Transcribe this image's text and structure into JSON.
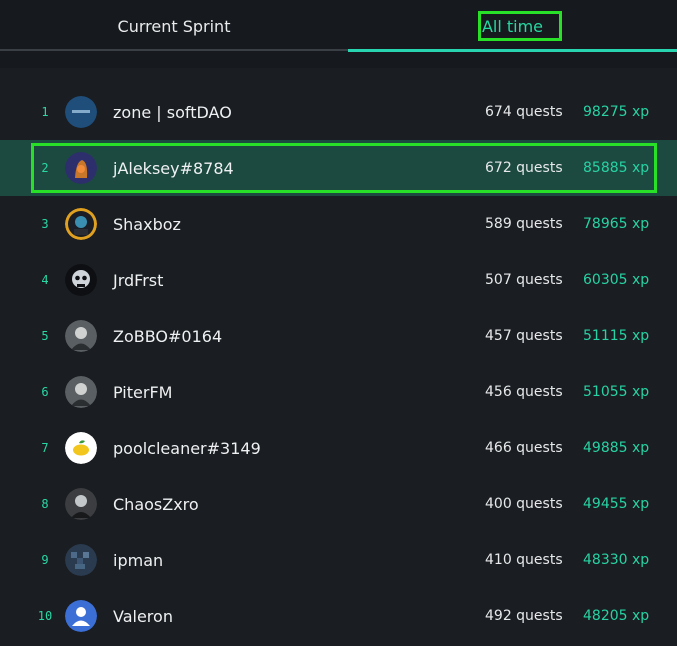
{
  "tabs": [
    {
      "label": "Current Sprint",
      "active": false
    },
    {
      "label": "All time",
      "active": true
    }
  ],
  "colors": {
    "accent": "#27d5b0",
    "selected_row": "#1d4a40",
    "highlight_box": "#27e027"
  },
  "leaderboard": [
    {
      "rank": "1",
      "name": "zone | softDAO",
      "quests": "674 quests",
      "xp": "98275 xp",
      "avatar": "softdao-logo-avatar"
    },
    {
      "rank": "2",
      "name": "jAleksey#8784",
      "quests": "672 quests",
      "xp": "85885 xp",
      "avatar": "hooded-figure-avatar",
      "selected": true
    },
    {
      "rank": "3",
      "name": "Shaxboz",
      "quests": "589 quests",
      "xp": "78965 xp",
      "avatar": "dark-character-avatar"
    },
    {
      "rank": "4",
      "name": "JrdFrst",
      "quests": "507 quests",
      "xp": "60305 xp",
      "avatar": "skull-avatar"
    },
    {
      "rank": "5",
      "name": "ZoBBO#0164",
      "quests": "457 quests",
      "xp": "51115 xp",
      "avatar": "character-avatar"
    },
    {
      "rank": "6",
      "name": "PiterFM",
      "quests": "456 quests",
      "xp": "51055 xp",
      "avatar": "character-avatar"
    },
    {
      "rank": "7",
      "name": "poolcleaner#3149",
      "quests": "466 quests",
      "xp": "49885 xp",
      "avatar": "lemon-avatar"
    },
    {
      "rank": "8",
      "name": "ChaosZxro",
      "quests": "400 quests",
      "xp": "49455 xp",
      "avatar": "portrait-avatar"
    },
    {
      "rank": "9",
      "name": "ipman",
      "quests": "410 quests",
      "xp": "48330 xp",
      "avatar": "pixel-avatar"
    },
    {
      "rank": "10",
      "name": "Valeron",
      "quests": "492 quests",
      "xp": "48205 xp",
      "avatar": "default-user-avatar"
    }
  ]
}
